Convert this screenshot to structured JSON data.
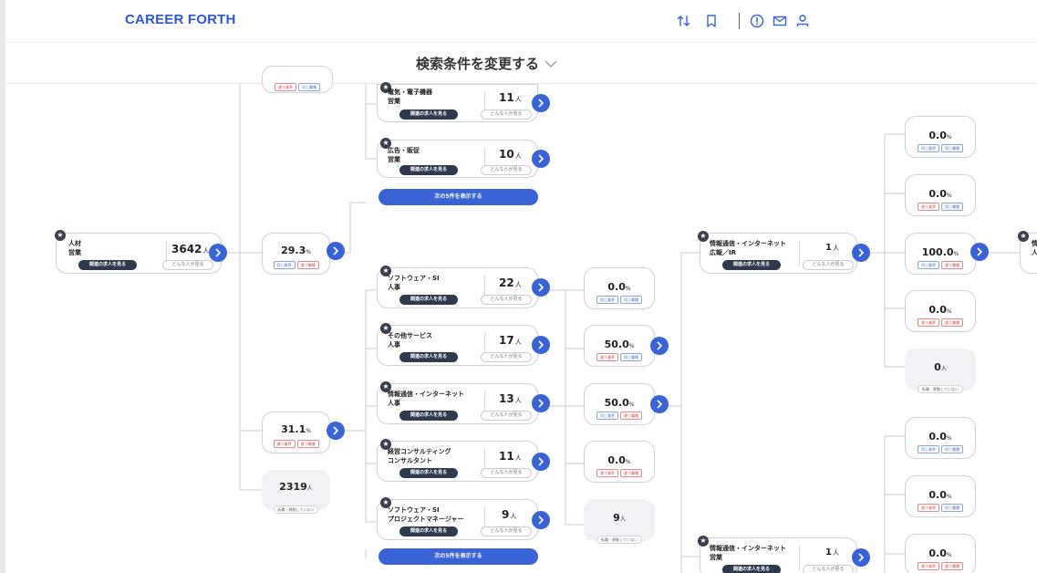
{
  "header": {
    "logo": "CAREER FORTH",
    "icons": [
      "sort-icon",
      "bookmark-icon",
      "info-icon",
      "mail-icon",
      "user-icon"
    ]
  },
  "search": {
    "label": "検索条件を変更する"
  },
  "labels": {
    "related_jobs": "関連の求人を見る",
    "who": "どんな人が見る",
    "same_industry": "同じ業界",
    "same_role": "同じ職種",
    "diff_industry": "違う業界",
    "diff_role": "違う職種",
    "no_change": "転職・異動していない",
    "show_next": "次の5件を表示する",
    "unit": "人",
    "pct_unit": "%"
  },
  "root": {
    "title": "人材\n営業",
    "count": "3642"
  },
  "level1": [
    {
      "pct": "29.3"
    },
    {
      "pct": "31.1"
    },
    {
      "count": "2319"
    }
  ],
  "cards_top": [
    {
      "title": "電気・電子機器\n営業",
      "count": "11"
    },
    {
      "title": "広告・販促\n営業",
      "count": "10"
    }
  ],
  "cards_mid": [
    {
      "title": "ソフトウェア・SI\n人事",
      "count": "22"
    },
    {
      "title": "その他サービス\n人事",
      "count": "17"
    },
    {
      "title": "情報通信・インターネット\n人事",
      "count": "13"
    },
    {
      "title": "経営コンサルティング\nコンサルタント",
      "count": "11"
    },
    {
      "title": "ソフトウェア・SI\nプロジェクトマネージャー",
      "count": "9"
    }
  ],
  "level3": [
    {
      "pct": "0.0"
    },
    {
      "pct": "50.0"
    },
    {
      "pct": "50.0"
    },
    {
      "pct": "0.0"
    },
    {
      "count": "9"
    }
  ],
  "right_cards": [
    {
      "title": "情報通信・インターネット\n広報／IR",
      "count": "1"
    },
    {
      "title": "情報通信・インターネット\n営業",
      "count": "1"
    }
  ],
  "level5_top": [
    {
      "pct": "0.0"
    },
    {
      "pct": "0.0"
    },
    {
      "pct": "100.0"
    },
    {
      "pct": "0.0"
    },
    {
      "count": "0"
    }
  ],
  "level5_bottom": [
    {
      "pct": "0.0"
    },
    {
      "pct": "0.0"
    },
    {
      "pct": "0.0"
    }
  ],
  "edge_card": {
    "title": "情\n人"
  }
}
